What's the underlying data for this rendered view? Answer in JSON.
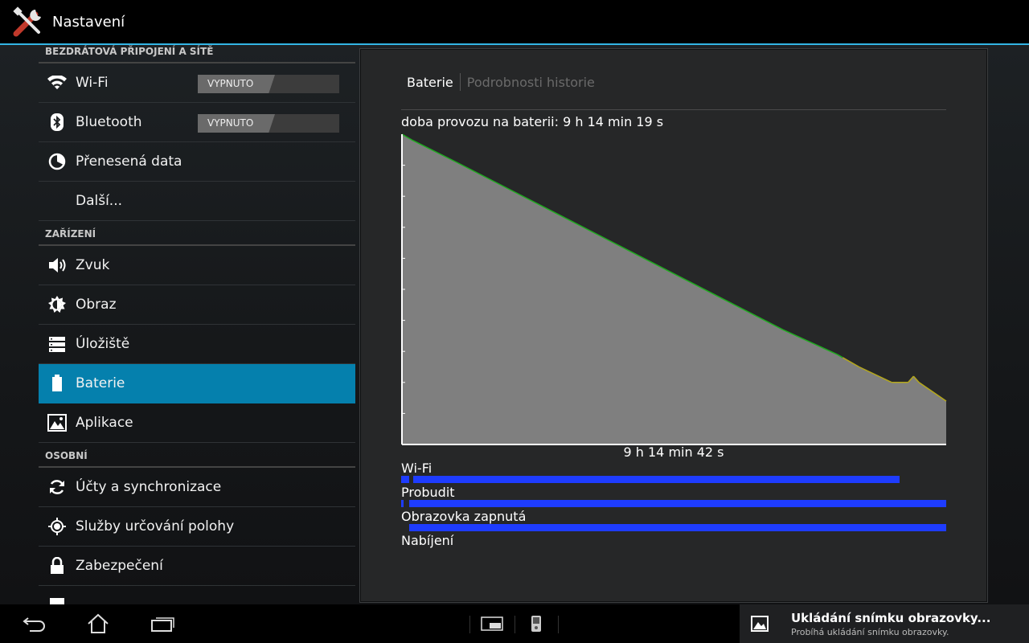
{
  "app": {
    "title": "Nastavení",
    "icon": "settings-tools-icon"
  },
  "sidebar": {
    "sections": [
      {
        "title": "BEZDRÁTOVÁ PŘIPOJENÍ A SÍTĚ",
        "items": [
          {
            "label": "Wi-Fi",
            "icon": "wifi-icon",
            "toggle": "VYPNUTO"
          },
          {
            "label": "Bluetooth",
            "icon": "bluetooth-icon",
            "toggle": "VYPNUTO"
          },
          {
            "label": "Přenesená data",
            "icon": "data-usage-icon"
          },
          {
            "label": "Další..."
          }
        ]
      },
      {
        "title": "ZAŘÍZENÍ",
        "items": [
          {
            "label": "Zvuk",
            "icon": "speaker-icon"
          },
          {
            "label": "Obraz",
            "icon": "brightness-icon"
          },
          {
            "label": "Úložiště",
            "icon": "storage-icon"
          },
          {
            "label": "Baterie",
            "icon": "battery-icon",
            "selected": true
          },
          {
            "label": "Aplikace",
            "icon": "apps-icon"
          }
        ]
      },
      {
        "title": "OSOBNÍ",
        "items": [
          {
            "label": "Účty a synchronizace",
            "icon": "sync-icon"
          },
          {
            "label": "Služby určování polohy",
            "icon": "location-icon"
          },
          {
            "label": "Zabezpečení",
            "icon": "lock-icon"
          }
        ]
      }
    ]
  },
  "battery": {
    "tabs": {
      "active": "Baterie",
      "inactive": "Podrobnosti historie"
    },
    "uptime": "doba provozu na baterii: 9 h 14 min 19 s",
    "duration": "9 h 14 min 42 s",
    "rows": [
      {
        "label": "Wi-Fi",
        "segments": [
          [
            0.0,
            0.015
          ],
          [
            0.022,
            0.915
          ]
        ]
      },
      {
        "label": "Probudit",
        "segments": [
          [
            0.0,
            0.004
          ],
          [
            0.015,
            1.0
          ]
        ]
      },
      {
        "label": "Obrazovka zapnutá",
        "segments": [
          [
            0.015,
            1.0
          ]
        ]
      },
      {
        "label": "Nabíjení",
        "segments": []
      }
    ]
  },
  "chart_data": {
    "type": "area",
    "x": [
      0.0,
      0.01,
      0.02,
      0.1,
      0.2,
      0.3,
      0.4,
      0.5,
      0.6,
      0.7,
      0.8,
      0.81,
      0.84,
      0.9,
      0.93,
      0.94,
      0.95,
      1.0
    ],
    "y": [
      100,
      99,
      98,
      91,
      82,
      73,
      64,
      55,
      46,
      37,
      29,
      28,
      25,
      20,
      20,
      22,
      20,
      14
    ],
    "xlabel": "9 h 14 min 42 s",
    "ylim": [
      0,
      100
    ],
    "ticks": 10,
    "colors": {
      "fill": "#7f7f7f",
      "line_good": "#1faa1f",
      "line_low": "#b5a81a",
      "axis": "#ffffff"
    }
  },
  "navbar": {
    "items": [
      "back-icon",
      "home-icon",
      "recent-apps-icon",
      "screen-window-icon",
      "device-icon"
    ]
  },
  "notification": {
    "title": "Ukládání snímku obrazovky...",
    "text": "Probíhá ukládání snímku obrazovky.",
    "icon": "image-icon"
  }
}
